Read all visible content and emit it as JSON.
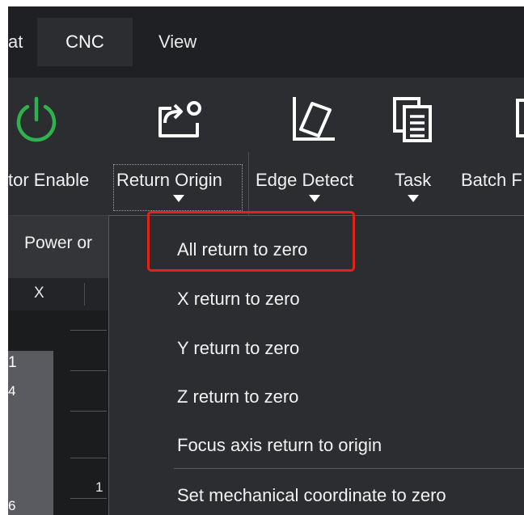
{
  "menubar": {
    "items": [
      {
        "label": "at"
      },
      {
        "label": "CNC"
      },
      {
        "label": "View"
      }
    ]
  },
  "ribbon": {
    "buttons": [
      {
        "label": "tor Enable",
        "icon": "power-icon",
        "color": "#2fb24c"
      },
      {
        "label": "Return Origin",
        "icon": "return-origin-icon"
      },
      {
        "label": "Edge Detect",
        "icon": "edge-detect-icon"
      },
      {
        "label": "Task",
        "icon": "task-icon"
      },
      {
        "label": "Batch F",
        "icon": "batch-icon"
      }
    ]
  },
  "group": {
    "label": "Power or"
  },
  "panel": {
    "column_header": "X",
    "gray_values": [
      "1",
      "4",
      "6"
    ],
    "tick_number": "1"
  },
  "dropdown": {
    "items": [
      {
        "label": "All return to zero"
      },
      {
        "label": "X return to zero"
      },
      {
        "label": "Y return to zero"
      },
      {
        "label": "Z return to zero"
      },
      {
        "label": "Focus axis return to origin"
      },
      {
        "label": "Set mechanical coordinate to zero"
      }
    ],
    "highlight_color": "#e0241b"
  }
}
